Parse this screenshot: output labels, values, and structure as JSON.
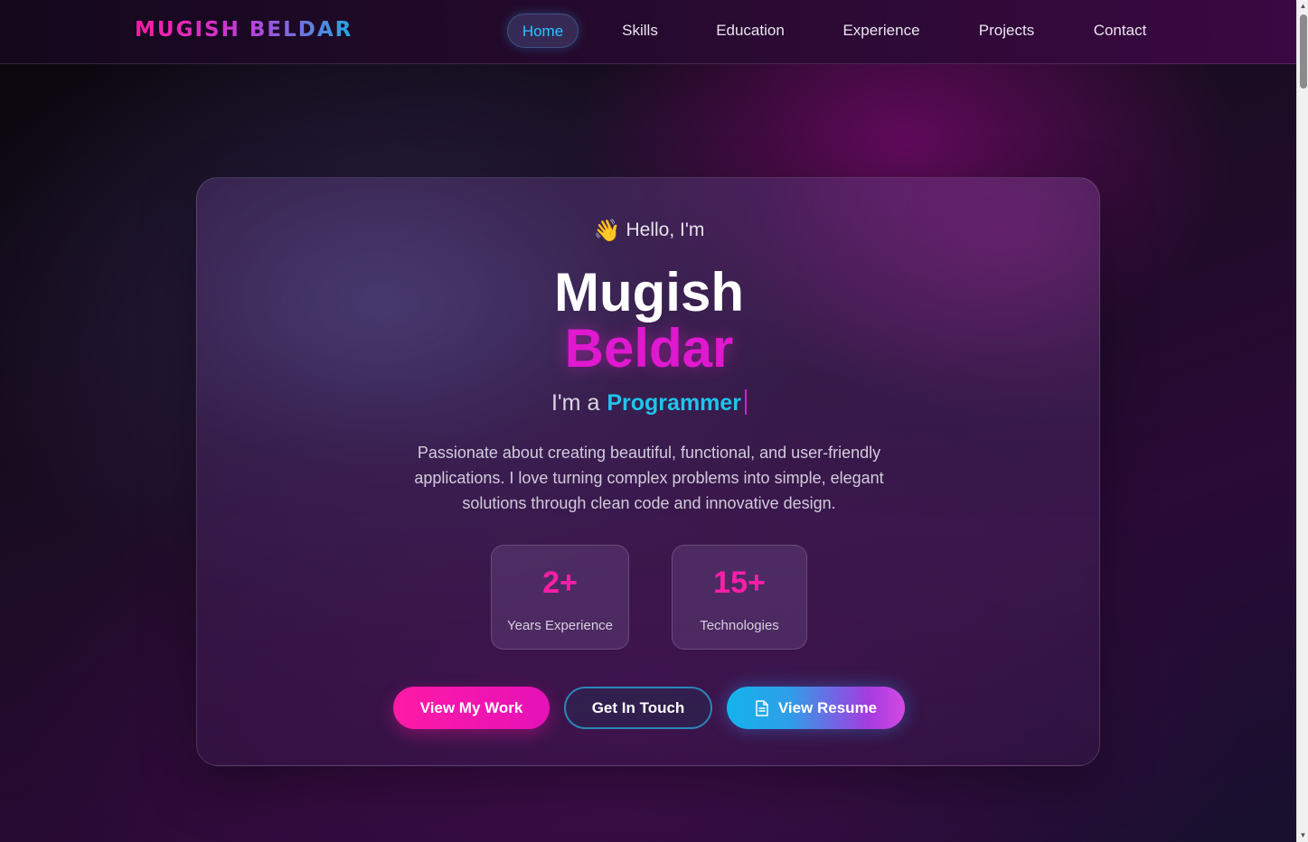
{
  "nav": {
    "logo_first": "MUGISH",
    "logo_last": "BELDAR",
    "links": [
      {
        "label": "Home",
        "active": true
      },
      {
        "label": "Skills",
        "active": false
      },
      {
        "label": "Education",
        "active": false
      },
      {
        "label": "Experience",
        "active": false
      },
      {
        "label": "Projects",
        "active": false
      },
      {
        "label": "Contact",
        "active": false
      }
    ]
  },
  "hero": {
    "greeting_icon": "waving-hand-icon",
    "greeting_emoji": "👋",
    "greeting": "Hello, I'm",
    "name_first": "Mugish",
    "name_last": "Beldar",
    "role_prefix": "I'm a",
    "role": "Programmer",
    "description": "Passionate about creating beautiful, functional, and user-friendly applications. I love turning complex problems into simple, elegant solutions through clean code and innovative design.",
    "stats": [
      {
        "value": "2+",
        "label": "Years Experience"
      },
      {
        "value": "15+",
        "label": "Technologies"
      }
    ],
    "buttons": {
      "view_work": "View My Work",
      "get_in_touch": "Get In Touch",
      "view_resume": "View Resume",
      "resume_icon": "document-icon"
    }
  },
  "colors": {
    "accent_pink": "#ff1aa6",
    "accent_cyan": "#1fc4ec",
    "accent_purple": "#a73ae0"
  }
}
